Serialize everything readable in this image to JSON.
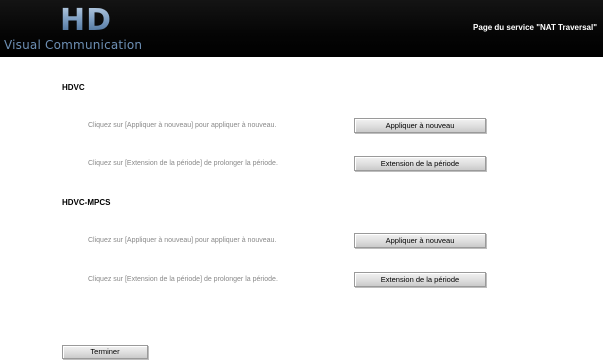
{
  "header": {
    "logo_mark": "HD",
    "logo_subtitle": "Visual Communication",
    "page_title": "Page du service \"NAT Traversal\""
  },
  "sections": [
    {
      "title": "HDVC",
      "rows": [
        {
          "instruction": "Cliquez sur [Appliquer à nouveau] pour appliquer à nouveau.",
          "button": "Appliquer à nouveau"
        },
        {
          "instruction": "Cliquez sur [Extension de la période] de prolonger la période.",
          "button": "Extension de la période"
        }
      ]
    },
    {
      "title": "HDVC-MPCS",
      "rows": [
        {
          "instruction": "Cliquez sur [Appliquer à nouveau] pour appliquer à nouveau.",
          "button": "Appliquer à nouveau"
        },
        {
          "instruction": "Cliquez sur [Extension de la période] de prolonger la période.",
          "button": "Extension de la période"
        }
      ]
    }
  ],
  "footer": {
    "finish_label": "Terminer"
  }
}
